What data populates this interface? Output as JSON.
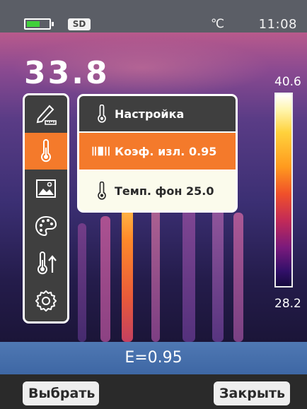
{
  "status": {
    "battery_level": 0.6,
    "storage_label": "SD",
    "unit": "℃",
    "time": "11:08"
  },
  "reading": {
    "value": "33.8"
  },
  "scale": {
    "max": "40.6",
    "min": "28.2"
  },
  "left_menu": {
    "items": [
      {
        "icon": "measure-ruler-icon",
        "active": false
      },
      {
        "icon": "thermometer-icon",
        "active": true
      },
      {
        "icon": "image-gallery-icon",
        "active": false
      },
      {
        "icon": "palette-icon",
        "active": false
      },
      {
        "icon": "thermometer-up-icon",
        "active": false
      },
      {
        "icon": "gear-icon",
        "active": false
      }
    ]
  },
  "submenu": {
    "title": "Настройка",
    "items": [
      {
        "label": "Коэф. изл. 0.95",
        "icon": "emissivity-bars-icon",
        "selected": true
      },
      {
        "label": "Темп. фон 25.0",
        "icon": "thermometer-icon",
        "selected": false
      }
    ]
  },
  "emissivity_bar": {
    "text": "E=0.95"
  },
  "softkeys": {
    "left": "Выбрать",
    "right": "Закрыть"
  },
  "colors": {
    "accent": "#f47a2b",
    "menu_bg": "#3f3f3f",
    "emissivity_bar": "#4f78b3"
  }
}
